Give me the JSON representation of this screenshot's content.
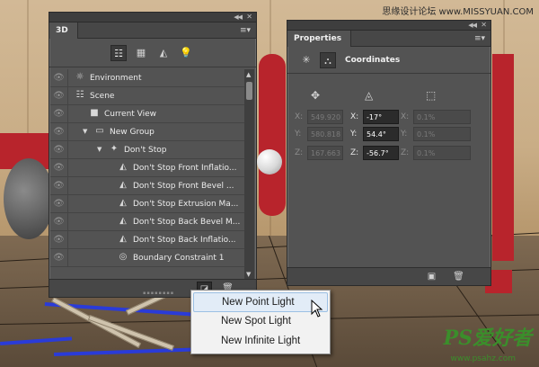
{
  "watermark": {
    "top": "思缘设计论坛 www.MISSYUAN.COM",
    "logo": "PS爱好者",
    "url": "www.psahz.com"
  },
  "panel3d": {
    "tab_label": "3D",
    "filter_icons": [
      "scene-filter-icon",
      "mesh-filter-icon",
      "material-filter-icon",
      "light-filter-icon"
    ],
    "tree": [
      {
        "label": "Environment",
        "icon": "environment-icon",
        "indent": 0
      },
      {
        "label": "Scene",
        "icon": "scene-icon",
        "indent": 0
      },
      {
        "label": "Current View",
        "icon": "camera-icon",
        "indent": 1
      },
      {
        "label": "New Group",
        "icon": "folder-icon",
        "indent": 1,
        "expanded": true
      },
      {
        "label": "Don't Stop",
        "icon": "mesh-icon",
        "indent": 2,
        "expanded": true
      },
      {
        "label": "Don't Stop Front Inflatio...",
        "icon": "material-icon",
        "indent": 3
      },
      {
        "label": "Don't Stop Front Bevel ...",
        "icon": "material-icon",
        "indent": 3
      },
      {
        "label": "Don't Stop Extrusion Ma...",
        "icon": "material-icon",
        "indent": 3
      },
      {
        "label": "Don't Stop Back Bevel M...",
        "icon": "material-icon",
        "indent": 3
      },
      {
        "label": "Don't Stop Back Inflatio...",
        "icon": "material-icon",
        "indent": 3
      },
      {
        "label": "Boundary Constraint 1",
        "icon": "constraint-icon",
        "indent": 3
      }
    ]
  },
  "properties": {
    "tab_label": "Properties",
    "section_title": "Coordinates",
    "rows": [
      {
        "position_label": "X:",
        "position_value": "549.920",
        "rotation_label": "X:",
        "rotation_value": "-17°",
        "scale_label": "X:",
        "scale_value": "0.1%"
      },
      {
        "position_label": "Y:",
        "position_value": "580.818",
        "rotation_label": "Y:",
        "rotation_value": "54.4°",
        "scale_label": "Y:",
        "scale_value": "0.1%"
      },
      {
        "position_label": "Z:",
        "position_value": "167.663",
        "rotation_label": "Z:",
        "rotation_value": "-56.7°",
        "scale_label": "Z:",
        "scale_value": "0.1%"
      }
    ]
  },
  "context_menu": {
    "items": [
      "New Point Light",
      "New Spot Light",
      "New Infinite Light"
    ],
    "hovered_index": 0
  },
  "colors": {
    "panel_bg": "#535353",
    "panel_dark": "#3e3e3e",
    "menu_bg": "#f2f2f2",
    "menu_hover": "#e2ecf7",
    "watermark_green": "#3b8e2b"
  }
}
